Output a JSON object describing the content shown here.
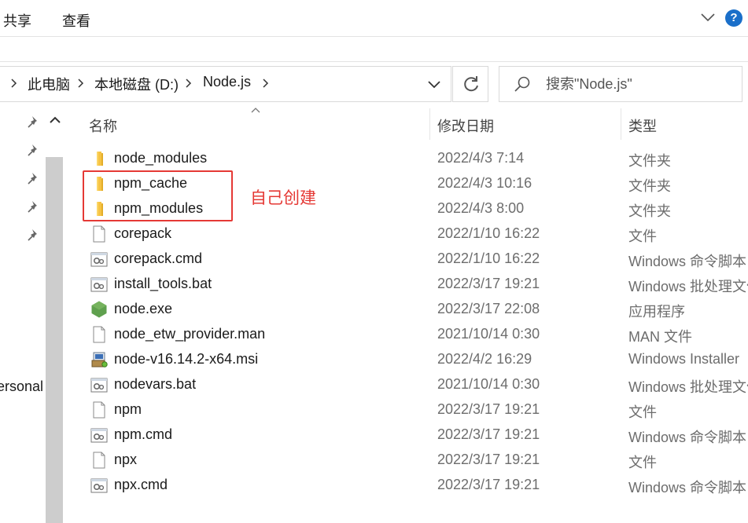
{
  "ribbon": {
    "tabs": [
      "共享",
      "查看"
    ],
    "help_label": "?"
  },
  "address": {
    "breadcrumbs": [
      "此电脑",
      "本地磁盘 (D:)",
      "Node.js"
    ]
  },
  "search": {
    "placeholder": "搜索\"Node.js\""
  },
  "nav": {
    "visible_item_label": "ersonal"
  },
  "columns": {
    "name": "名称",
    "modified": "修改日期",
    "type": "类型"
  },
  "files": [
    {
      "name": "node_modules",
      "modified": "2022/4/3 7:14",
      "type": "文件夹",
      "icon": "folder-icon"
    },
    {
      "name": "npm_cache",
      "modified": "2022/4/3 10:16",
      "type": "文件夹",
      "icon": "folder-icon"
    },
    {
      "name": "npm_modules",
      "modified": "2022/4/3 8:00",
      "type": "文件夹",
      "icon": "folder-icon"
    },
    {
      "name": "corepack",
      "modified": "2022/1/10 16:22",
      "type": "文件",
      "icon": "file-icon"
    },
    {
      "name": "corepack.cmd",
      "modified": "2022/1/10 16:22",
      "type": "Windows 命令脚本",
      "icon": "script-file-icon"
    },
    {
      "name": "install_tools.bat",
      "modified": "2022/3/17 19:21",
      "type": "Windows 批处理文件",
      "icon": "script-file-icon"
    },
    {
      "name": "node.exe",
      "modified": "2022/3/17 22:08",
      "type": "应用程序",
      "icon": "nodejs-hexagon-icon"
    },
    {
      "name": "node_etw_provider.man",
      "modified": "2021/10/14 0:30",
      "type": "MAN 文件",
      "icon": "file-icon"
    },
    {
      "name": "node-v16.14.2-x64.msi",
      "modified": "2022/4/2 16:29",
      "type": "Windows Installer",
      "icon": "installer-package-icon"
    },
    {
      "name": "nodevars.bat",
      "modified": "2021/10/14 0:30",
      "type": "Windows 批处理文件",
      "icon": "script-file-icon"
    },
    {
      "name": "npm",
      "modified": "2022/3/17 19:21",
      "type": "文件",
      "icon": "file-icon"
    },
    {
      "name": "npm.cmd",
      "modified": "2022/3/17 19:21",
      "type": "Windows 命令脚本",
      "icon": "script-file-icon"
    },
    {
      "name": "npx",
      "modified": "2022/3/17 19:21",
      "type": "文件",
      "icon": "file-icon"
    },
    {
      "name": "npx.cmd",
      "modified": "2022/3/17 19:21",
      "type": "Windows 命令脚本",
      "icon": "script-file-icon"
    }
  ],
  "annotation": {
    "text": "自己创建",
    "color": "#e53935"
  },
  "colors": {
    "folder": "#f6c343",
    "accent": "#1a6fc9",
    "nodejs": "#5fa04e"
  }
}
